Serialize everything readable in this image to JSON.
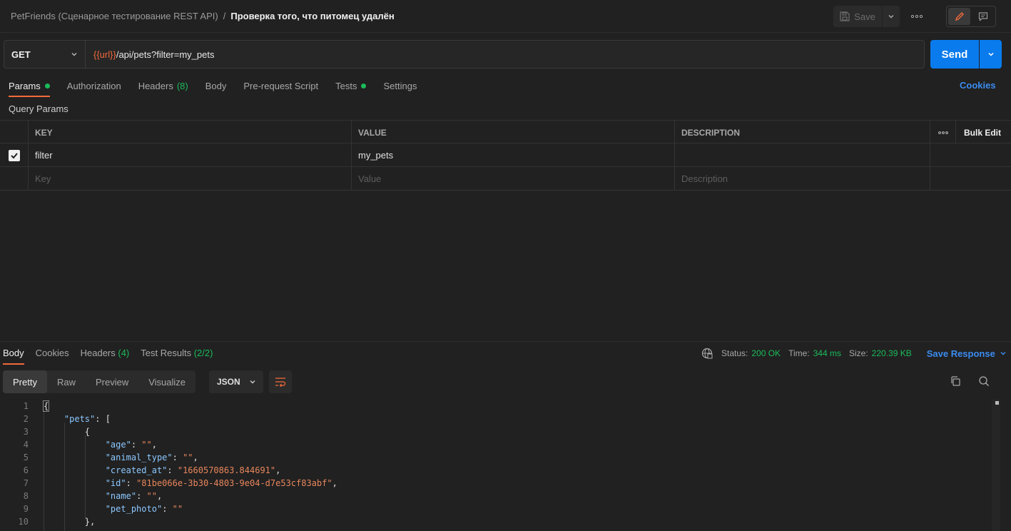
{
  "breadcrumb": {
    "collection": "PetFriends (Сценарное тестирование REST API)",
    "separator": "/",
    "request": "Проверка того, что питомец удалён"
  },
  "toolbar": {
    "save_label": "Save",
    "more_label": "ooo"
  },
  "request": {
    "method": "GET",
    "url_variable": "{{url}}",
    "url_path": "/api/pets?filter=my_pets",
    "send_label": "Send"
  },
  "request_tabs": {
    "params": "Params",
    "authorization": "Authorization",
    "headers": "Headers",
    "headers_count": "(8)",
    "body": "Body",
    "prerequest": "Pre-request Script",
    "tests": "Tests",
    "settings": "Settings",
    "cookies": "Cookies"
  },
  "query_params": {
    "title": "Query Params",
    "columns": {
      "key": "KEY",
      "value": "VALUE",
      "description": "DESCRIPTION",
      "more": "ooo",
      "bulk_edit": "Bulk Edit"
    },
    "rows": [
      {
        "key": "filter",
        "value": "my_pets",
        "description": "",
        "checked": true
      }
    ],
    "placeholders": {
      "key": "Key",
      "value": "Value",
      "description": "Description"
    }
  },
  "response": {
    "tabs": {
      "body": "Body",
      "cookies": "Cookies",
      "headers": "Headers",
      "headers_count": "(4)",
      "test_results": "Test Results",
      "test_results_count": "(2/2)"
    },
    "status_label": "Status:",
    "status_value": "200 OK",
    "time_label": "Time:",
    "time_value": "344 ms",
    "size_label": "Size:",
    "size_value": "220.39 KB",
    "save_response": "Save Response",
    "view_tabs": {
      "pretty": "Pretty",
      "raw": "Raw",
      "preview": "Preview",
      "visualize": "Visualize"
    },
    "format": "JSON",
    "line_numbers": [
      "1",
      "2",
      "3",
      "4",
      "5",
      "6",
      "7",
      "8",
      "9",
      "10"
    ],
    "code": {
      "l1": "{",
      "l2_key": "\"pets\"",
      "l2_rest": ": [",
      "l3": "{",
      "l4_key": "\"age\"",
      "l4_val": "\"\"",
      "l5_key": "\"animal_type\"",
      "l5_val": "\"\"",
      "l6_key": "\"created_at\"",
      "l6_val": "\"1660570863.844691\"",
      "l7_key": "\"id\"",
      "l7_val": "\"81be066e-3b30-4803-9e04-d7e53cf83abf\"",
      "l8_key": "\"name\"",
      "l8_val": "\"\"",
      "l9_key": "\"pet_photo\"",
      "l9_val": "\"\"",
      "l10": "},"
    }
  },
  "colors": {
    "accent": "#f26b3a",
    "send": "#097bed",
    "success": "#1bbb5a",
    "link": "#3b8cf0",
    "json_key": "#8cc8ff",
    "json_string": "#e8865c"
  }
}
